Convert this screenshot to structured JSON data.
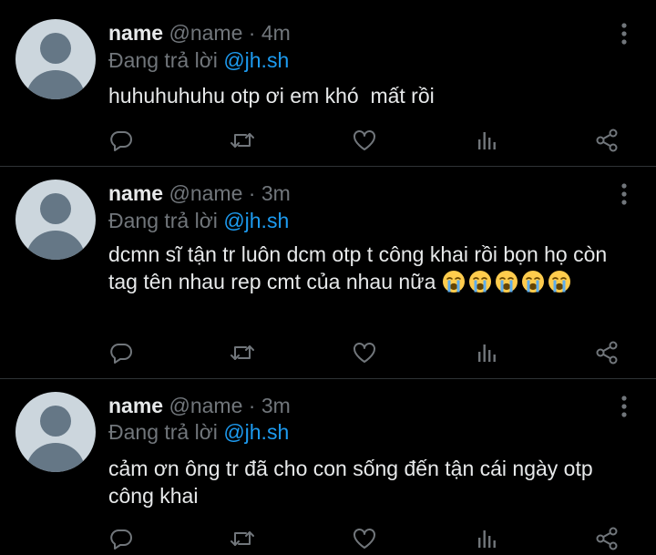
{
  "tweets": [
    {
      "name": "name",
      "handle": "@name",
      "separator": "·",
      "time": "4m",
      "replying_prefix": "Đang trả lời",
      "replying_to": "@jh.sh",
      "text": "huhuhuhuhu otp ơi em khó  mất rồi",
      "emojis": []
    },
    {
      "name": "name",
      "handle": "@name",
      "separator": "·",
      "time": "3m",
      "replying_prefix": "Đang trả lời",
      "replying_to": "@jh.sh",
      "text": "dcmn sĩ tận tr luôn dcm otp t công khai rồi bọn họ còn tag tên nhau rep cmt của nhau nữa ",
      "emojis": [
        "loudly-crying-face-icon",
        "loudly-crying-face-icon",
        "loudly-crying-face-icon",
        "loudly-crying-face-icon",
        "loudly-crying-face-icon"
      ]
    },
    {
      "name": "name",
      "handle": "@name",
      "separator": "·",
      "time": "3m",
      "replying_prefix": "Đang trả lời",
      "replying_to": "@jh.sh",
      "text": "cảm ơn ông tr đã cho con sống đến tận cái ngày otp công khai",
      "emojis": []
    }
  ],
  "icons": {
    "more": "more-vertical-icon",
    "reply": "reply-bubble-icon",
    "retweet": "retweet-icon",
    "like": "heart-icon",
    "analytics": "analytics-bars-icon",
    "share": "share-icon"
  },
  "colors": {
    "background": "#000000",
    "text": "#e7e9ea",
    "muted": "#71767b",
    "accent": "#1d9bf0",
    "divider": "#2f3336",
    "avatar_bg": "#ccd6dd",
    "avatar_fg": "#657786"
  }
}
